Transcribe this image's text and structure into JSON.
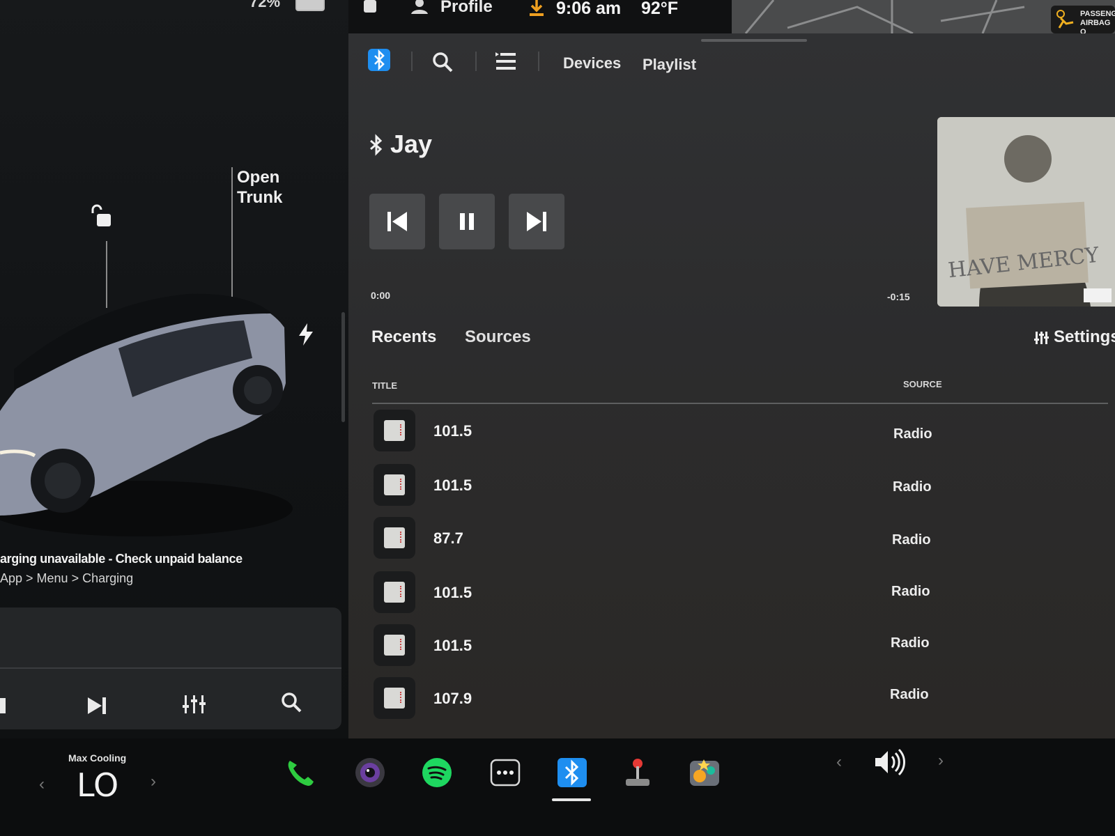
{
  "status_bar": {
    "battery_percent": "72%",
    "profile_label": "Profile",
    "time": "9:06 am",
    "temperature": "92°F",
    "airbag_line1": "PASSENG",
    "airbag_line2": "AIRBAG O"
  },
  "vehicle": {
    "trunk_line1": "Open",
    "trunk_line2": "Trunk",
    "charging_message": "arging unavailable - Check unpaid balance",
    "charging_path": "App > Menu > Charging"
  },
  "media_tabs": {
    "devices": "Devices",
    "playlist": "Playlist"
  },
  "now_playing": {
    "title": "Jay",
    "elapsed": "0:00",
    "remaining": "-0:15",
    "album_art_text": "HAVE MERCY"
  },
  "library": {
    "tabs": [
      "Recents",
      "Sources"
    ],
    "settings_label": "Settings",
    "columns": {
      "title": "TITLE",
      "source": "SOURCE"
    },
    "rows": [
      {
        "title": "101.5",
        "source": "Radio"
      },
      {
        "title": "101.5",
        "source": "Radio"
      },
      {
        "title": "87.7",
        "source": "Radio"
      },
      {
        "title": "101.5",
        "source": "Radio"
      },
      {
        "title": "101.5",
        "source": "Radio"
      },
      {
        "title": "107.9",
        "source": "Radio"
      }
    ]
  },
  "climate": {
    "mode": "Max Cooling",
    "setting": "LO"
  },
  "dock": {
    "apps": [
      "phone-icon",
      "camera-icon",
      "spotify-icon",
      "more-apps-icon",
      "bluetooth-icon",
      "joystick-icon",
      "toybox-icon"
    ],
    "active_app": "bluetooth-icon"
  },
  "colors": {
    "bluetooth_blue": "#1e8ef0",
    "phone_green": "#2ecc40",
    "spotify_green": "#1ed760",
    "panel_dark": "#2e2f31"
  }
}
